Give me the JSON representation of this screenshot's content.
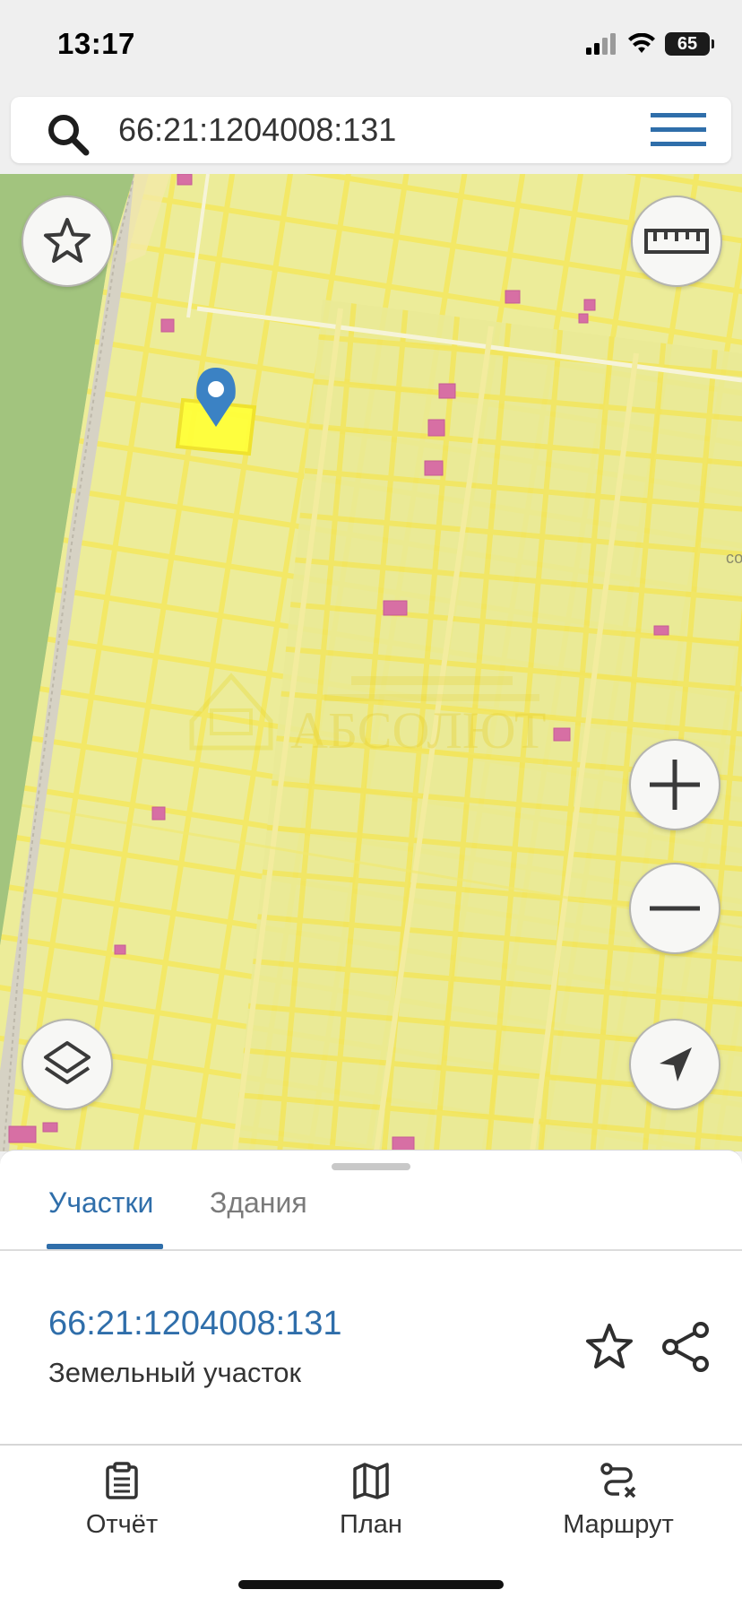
{
  "status_bar": {
    "time": "13:17",
    "battery": "65"
  },
  "search": {
    "value": "66:21:1204008:131"
  },
  "map": {
    "watermark": "АБСОЛЮТ",
    "edge_label": "со"
  },
  "sheet": {
    "tabs": [
      {
        "label": "Участки",
        "active": true
      },
      {
        "label": "Здания",
        "active": false
      }
    ],
    "parcel": {
      "id": "66:21:1204008:131",
      "type": "Земельный участок"
    }
  },
  "bottom_nav": [
    {
      "label": "Отчёт",
      "icon": "clipboard-icon"
    },
    {
      "label": "План",
      "icon": "map-icon"
    },
    {
      "label": "Маршрут",
      "icon": "route-icon"
    }
  ],
  "colors": {
    "accent": "#2f6eaa",
    "map_fill": "#ecec99",
    "parcel_line": "#f2e35a",
    "building": "#d76fa4",
    "marker": "#3b82c4"
  }
}
